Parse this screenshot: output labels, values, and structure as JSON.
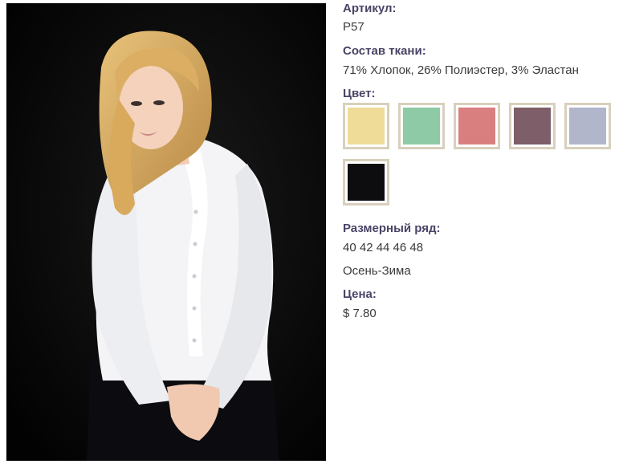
{
  "product": {
    "article_label": "Артикул:",
    "article_value": "P57",
    "fabric_label": "Состав ткани:",
    "fabric_value": "71% Хлопок, 26% Полиэстер, 3% Эластан",
    "color_label": "Цвет:",
    "colors": [
      {
        "name": "yellow",
        "hex": "#eedc98"
      },
      {
        "name": "mint",
        "hex": "#8fcaa6"
      },
      {
        "name": "pink",
        "hex": "#d97f80"
      },
      {
        "name": "mauve",
        "hex": "#7e5e69"
      },
      {
        "name": "light-blue",
        "hex": "#b2b6cb"
      },
      {
        "name": "black",
        "hex": "#0d0d0f"
      }
    ],
    "size_label": "Размерный ряд:",
    "size_value": "40 42 44 46 48",
    "season_value": "Осень-Зима",
    "price_label": "Цена:",
    "price_value": "$ 7.80"
  }
}
